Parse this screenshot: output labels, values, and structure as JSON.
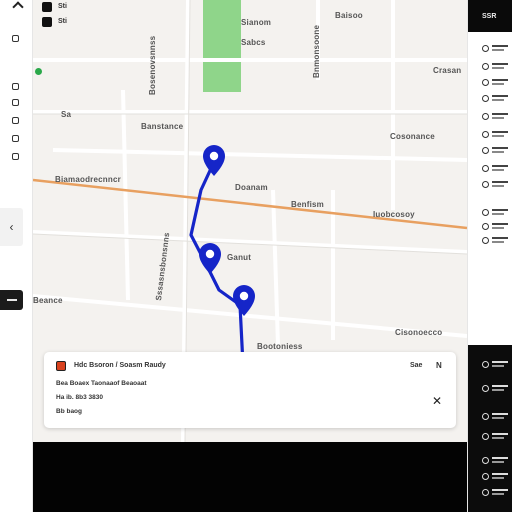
{
  "top_left": {
    "label_1": "Sti",
    "label_2": "Sti"
  },
  "right_panel": {
    "header": "SSR"
  },
  "map": {
    "labels": [
      {
        "id": "top-center",
        "text": "Sianom"
      },
      {
        "id": "top-center-2",
        "text": "Sabcs"
      },
      {
        "id": "top-right",
        "text": "Crasan"
      },
      {
        "id": "left-1",
        "text": "Sa"
      },
      {
        "id": "left-2",
        "text": "Banstance"
      },
      {
        "id": "center-upper",
        "text": "Baisoo"
      },
      {
        "id": "right-upper",
        "text": "Cosonance"
      },
      {
        "id": "main-road-left",
        "text": "Biamaodrecnncr"
      },
      {
        "id": "main-road-center",
        "text": "Doanam"
      },
      {
        "id": "main-road-right",
        "text": "Benfism"
      },
      {
        "id": "main-road-far-right",
        "text": "Iuobcosoy"
      },
      {
        "id": "mid-right",
        "text": "Ganut"
      },
      {
        "id": "lower-left",
        "text": "Beance"
      },
      {
        "id": "lower-right",
        "text": "Cisonoecco"
      },
      {
        "id": "bottom-center",
        "text": "Bootoniess"
      }
    ],
    "vertical_labels": [
      {
        "id": "v-center",
        "text": "Bosenovsnnss"
      },
      {
        "id": "v-lower",
        "text": "Sssasnsbonsnns"
      },
      {
        "id": "v-right",
        "text": "Bnmonsoone"
      }
    ]
  },
  "info_card": {
    "title": "Hdc Bsoron / Soasm Raudy",
    "line_1": "Bea Boaex Taonaaof Beaoaat",
    "line_2": "Ha ib. 8b3 3830",
    "line_3": "Bb baog",
    "save_label": "Sae",
    "extra_label": "N",
    "close_glyph": "✕"
  },
  "colors": {
    "route": "#1525c8",
    "main_road": "#e8a060",
    "park": "#8fd58a",
    "map_bg": "#f4f2ef"
  }
}
